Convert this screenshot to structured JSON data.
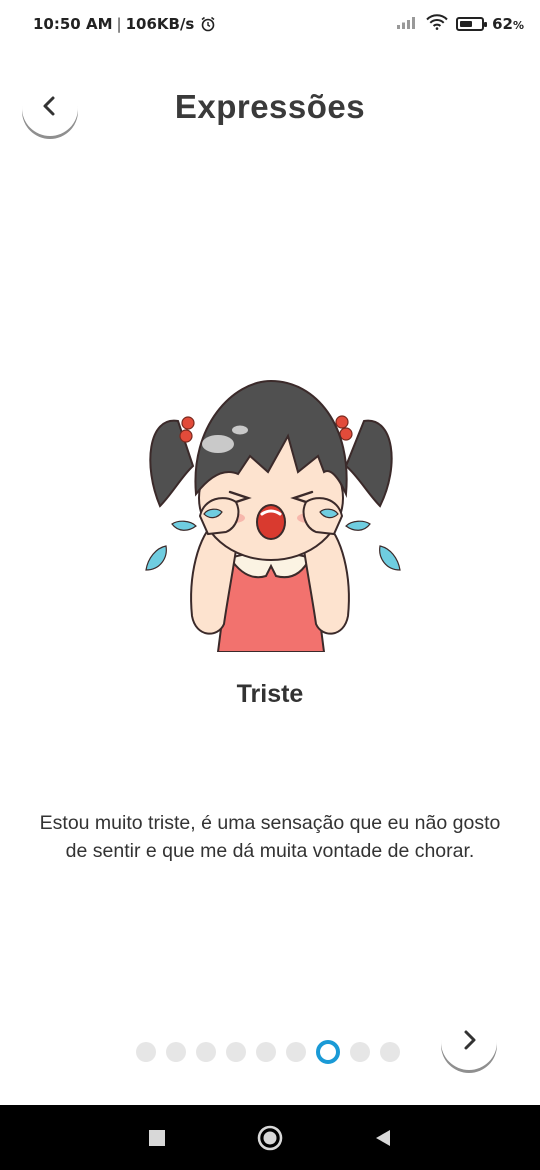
{
  "status_bar": {
    "time": "10:50 AM",
    "separator": "|",
    "speed": "106KB/s",
    "battery_percent": "62",
    "battery_symbol": "%",
    "battery_level": 0.62,
    "icons": [
      "alarm-icon",
      "signal-icon",
      "wifi-icon",
      "battery-icon"
    ]
  },
  "header": {
    "title": "Expressões",
    "back_icon": "chevron-left-icon"
  },
  "emotion": {
    "name": "Triste",
    "description": "Estou muito triste, é uma sensação que eu não gosto de sentir e que me dá muita vontade de chorar.",
    "illustration": "crying-girl-illustration"
  },
  "pager": {
    "total": 9,
    "active_index": 6,
    "active_color": "#1a9ad6",
    "next_icon": "chevron-right-icon"
  },
  "nav_bar": {
    "icons": [
      "recent-apps-square-icon",
      "home-circle-icon",
      "back-triangle-icon"
    ]
  }
}
